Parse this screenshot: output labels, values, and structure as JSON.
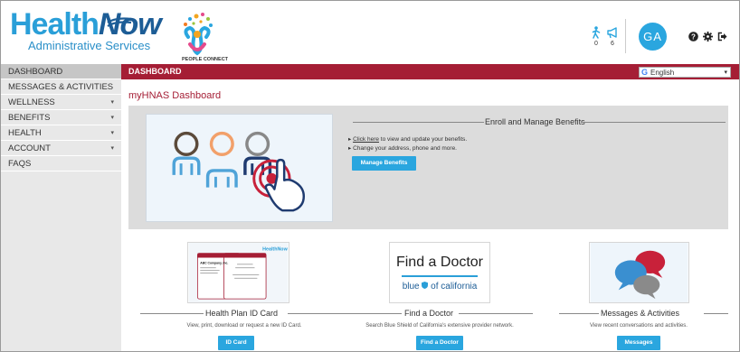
{
  "header": {
    "logo_primary": "Health",
    "logo_secondary": "Now",
    "logo_subtitle": "Administrative Services",
    "partner_logo_text": "PEOPLE CONNECT",
    "activity_count": "0",
    "announcement_count": "6",
    "avatar_initials": "GA"
  },
  "sidebar": {
    "items": [
      {
        "label": "DASHBOARD",
        "caret": ""
      },
      {
        "label": "MESSAGES & ACTIVITIES",
        "caret": ""
      },
      {
        "label": "WELLNESS",
        "caret": "▾"
      },
      {
        "label": "BENEFITS",
        "caret": "▾"
      },
      {
        "label": "HEALTH",
        "caret": "▾"
      },
      {
        "label": "ACCOUNT",
        "caret": "▾"
      },
      {
        "label": "FAQS",
        "caret": ""
      }
    ]
  },
  "titlebar": {
    "label": "DASHBOARD",
    "language": "English"
  },
  "main": {
    "page_title": "myHNAS Dashboard",
    "enroll": {
      "heading": "Enroll and Manage Benefits",
      "link_text": "Click here",
      "bullet1_rest": " to view and update your benefits.",
      "bullet2": "Change your address, phone and more.",
      "button": "Manage Benefits"
    },
    "cards": [
      {
        "heading": "Health Plan ID Card",
        "caption": "View, print, download or request a new ID Card.",
        "button": "ID Card",
        "image_text": {
          "brand": "HealthNow",
          "company": "ABC Company, Inc."
        }
      },
      {
        "heading": "Find a Doctor",
        "caption": "Search Blue Shield of California's extensive provider network.",
        "button": "Find a Doctor",
        "image_text": {
          "title": "Find a Doctor",
          "subtitle_pre": "blue",
          "subtitle_post": "of california"
        }
      },
      {
        "heading": "Messages & Activities",
        "caption": "View recent conversations and activities.",
        "button": "Messages"
      }
    ]
  },
  "colors": {
    "accent_blue": "#2aa6df",
    "titlebar_red": "#a51e35",
    "logo_blue": "#1d5d96"
  },
  "icons": [
    "person-walking-icon",
    "megaphone-icon",
    "help-icon",
    "gear-icon",
    "logout-icon",
    "shield-icon"
  ]
}
